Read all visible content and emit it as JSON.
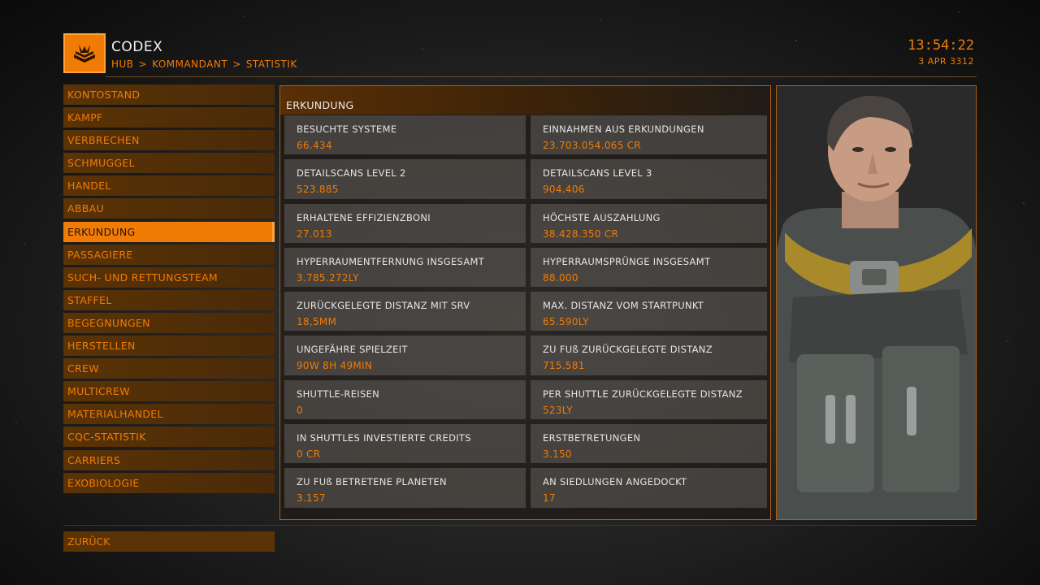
{
  "header": {
    "title": "CODEX",
    "breadcrumb": [
      "HUB",
      "KOMMANDANT",
      "STATISTIK"
    ],
    "breadcrumb_sep": ">",
    "time": "13:54:22",
    "date": "3 APR 3312"
  },
  "colors": {
    "accent": "#f07b05",
    "panel_border": "#b06010",
    "cell_bg": "#5f5b58"
  },
  "sidebar": {
    "items": [
      {
        "label": "KONTOSTAND"
      },
      {
        "label": "KAMPF"
      },
      {
        "label": "VERBRECHEN"
      },
      {
        "label": "SCHMUGGEL"
      },
      {
        "label": "HANDEL"
      },
      {
        "label": "ABBAU"
      },
      {
        "label": "ERKUNDUNG",
        "active": true
      },
      {
        "label": "PASSAGIERE"
      },
      {
        "label": "SUCH- UND RETTUNGSTEAM"
      },
      {
        "label": "STAFFEL"
      },
      {
        "label": "BEGEGNUNGEN"
      },
      {
        "label": "HERSTELLEN"
      },
      {
        "label": "CREW"
      },
      {
        "label": "MULTICREW"
      },
      {
        "label": "MATERIALHANDEL"
      },
      {
        "label": "CQC-STATISTIK"
      },
      {
        "label": "CARRIERS"
      },
      {
        "label": "EXOBIOLOGIE"
      }
    ],
    "back_label": "ZURÜCK"
  },
  "panel": {
    "title": "ERKUNDUNG",
    "stats": [
      {
        "label": "BESUCHTE SYSTEME",
        "value": "66.434"
      },
      {
        "label": "EINNAHMEN AUS ERKUNDUNGEN",
        "value": "23.703.054.065 CR"
      },
      {
        "label": "DETAILSCANS LEVEL 2",
        "value": "523.885"
      },
      {
        "label": "DETAILSCANS LEVEL 3",
        "value": "904.406"
      },
      {
        "label": "ERHALTENE EFFIZIENZBONI",
        "value": "27.013"
      },
      {
        "label": "HÖCHSTE AUSZAHLUNG",
        "value": "38.428.350 CR"
      },
      {
        "label": "HYPERRAUMENTFERNUNG INSGESAMT",
        "value": "3.785.272LY"
      },
      {
        "label": "HYPERRAUMSPRÜNGE INSGESAMT",
        "value": "88.000"
      },
      {
        "label": "ZURÜCKGELEGTE DISTANZ MIT SRV",
        "value": "18,5MM"
      },
      {
        "label": "MAX. DISTANZ VOM STARTPUNKT",
        "value": "65.590LY"
      },
      {
        "label": "UNGEFÄHRE SPIELZEIT",
        "value": "90W 8H 49MIN"
      },
      {
        "label": "ZU FUß ZURÜCKGELEGTE DISTANZ",
        "value": "715.581"
      },
      {
        "label": "SHUTTLE-REISEN",
        "value": "0"
      },
      {
        "label": "PER SHUTTLE ZURÜCKGELEGTE DISTANZ",
        "value": "523LY"
      },
      {
        "label": "IN SHUTTLES INVESTIERTE CREDITS",
        "value": "0 CR"
      },
      {
        "label": "ERSTBETRETUNGEN",
        "value": "3.150"
      },
      {
        "label": "ZU FUß BETRETENE PLANETEN",
        "value": "3.157"
      },
      {
        "label": "AN SIEDLUNGEN ANGEDOCKT",
        "value": "17"
      }
    ]
  },
  "icons": {
    "logo": "codex-book-icon",
    "portrait": "commander-portrait"
  }
}
